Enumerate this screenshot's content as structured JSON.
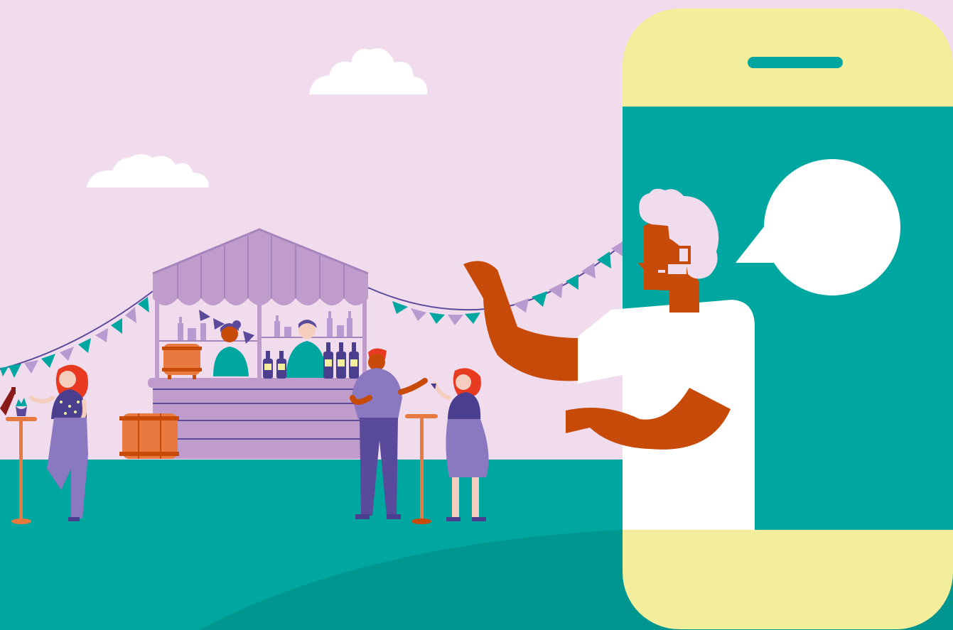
{
  "scene": {
    "description_free": true,
    "colors": {
      "sky": "#f0dcec",
      "ground": "#00a6a0",
      "ground_shadow": "#009690",
      "phone_yellow": "#f3ee9c",
      "phone_teal": "#00a6a0",
      "speaker": "#00a6a0",
      "bubble": "#ffffff",
      "skin": "#c84a08",
      "hair": "#f0dcec",
      "shirt": "#ffffff",
      "stall_purple": "#c09ccc",
      "stall_dark": "#5a4a9c",
      "barrel": "#e87a40",
      "barrel_band": "#c84a08",
      "flag_teal": "#00a6a0",
      "flag_purple": "#b89ad0",
      "string": "#5a4a9c",
      "bottle": "#4a3f8f",
      "label": "#f3ee9c",
      "pants": "#5a4a9c",
      "dress": "#8a78c0",
      "red_hair": "#e83a20",
      "pale_skin": "#f5cdbf"
    },
    "icons": [
      "cloud-icon",
      "speech-bubble-icon",
      "phone-speaker-icon"
    ]
  }
}
